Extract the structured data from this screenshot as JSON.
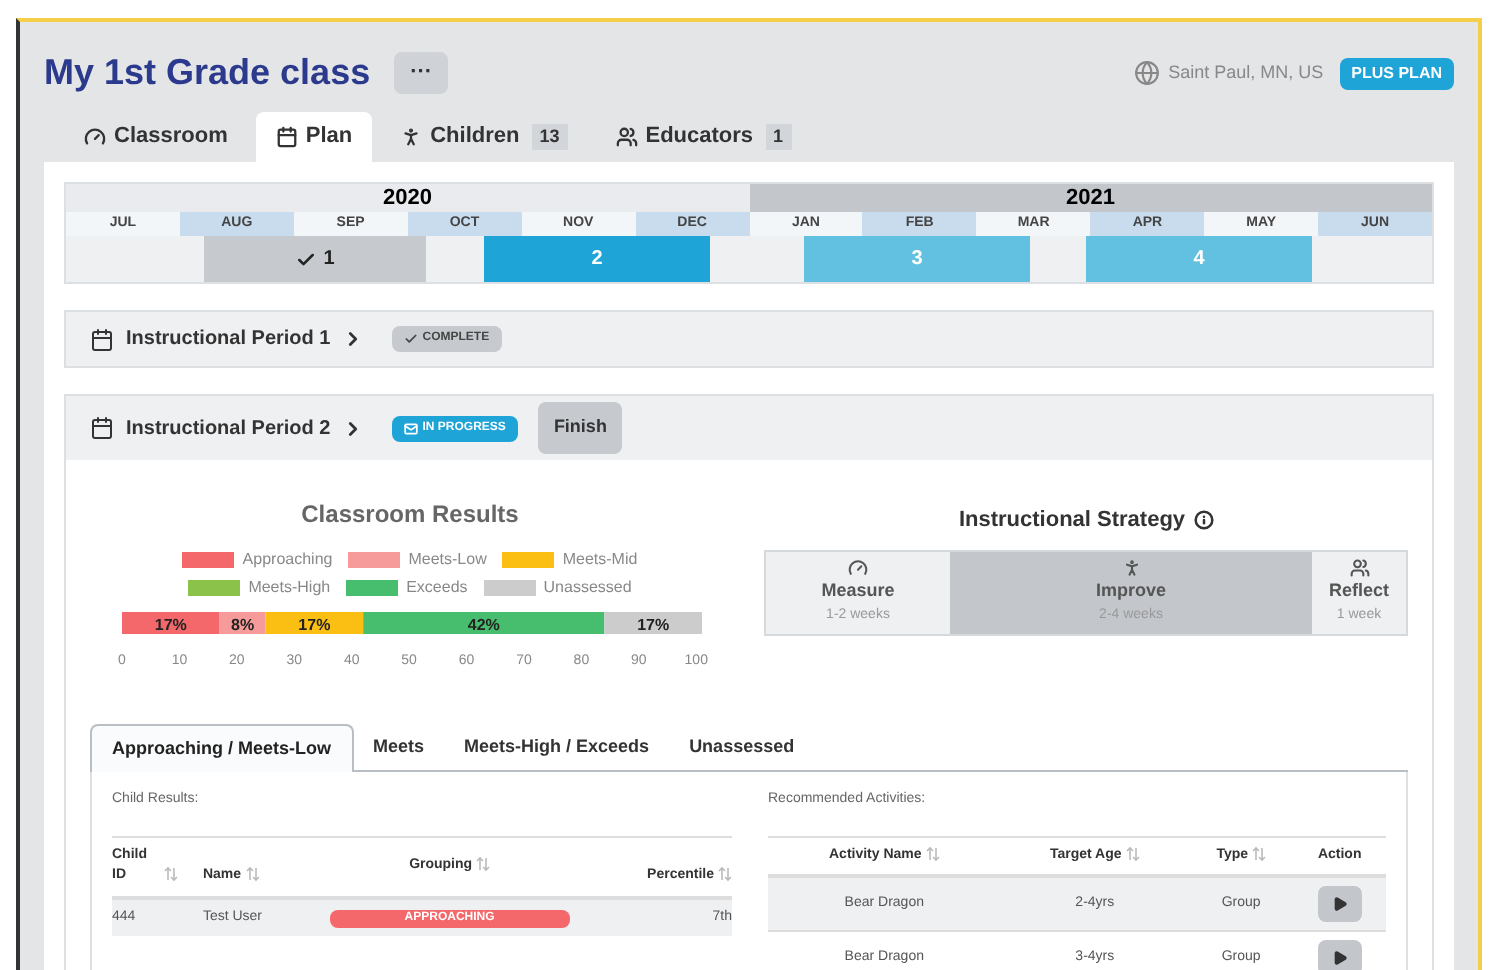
{
  "header": {
    "title": "My 1st Grade class",
    "more_button": "···",
    "location": "Saint Paul, MN, US",
    "plan_badge": "PLUS PLAN"
  },
  "tabs": [
    {
      "label": "Classroom",
      "selected": false
    },
    {
      "label": "Plan",
      "selected": true
    },
    {
      "label": "Children",
      "count": "13",
      "selected": false
    },
    {
      "label": "Educators",
      "count": "1",
      "selected": false
    }
  ],
  "timeline": {
    "years": [
      {
        "label": "2020",
        "kind": "past"
      },
      {
        "label": "2021",
        "kind": "future"
      }
    ],
    "months": [
      "JUL",
      "AUG",
      "SEP",
      "OCT",
      "NOV",
      "DEC",
      "JAN",
      "FEB",
      "MAR",
      "APR",
      "MAY",
      "JUN"
    ],
    "periods": [
      {
        "label": "1",
        "kind": "complete"
      },
      {
        "label": "2",
        "kind": "current"
      },
      {
        "label": "3",
        "kind": "upcoming"
      },
      {
        "label": "4",
        "kind": "upcoming"
      }
    ]
  },
  "periods": [
    {
      "title": "Instructional Period 1",
      "status": "COMPLETE",
      "kind": "complete"
    },
    {
      "title": "Instructional Period 2",
      "status": "IN PROGRESS",
      "kind": "current",
      "action": "Finish"
    }
  ],
  "classroom_results": {
    "chart_data": {
      "type": "bar",
      "title": "Classroom Results",
      "orientation": "horizontal",
      "stacked": true,
      "legend": true,
      "series": [
        {
          "name": "Approaching",
          "color": "#f4686b",
          "values": [
            17
          ]
        },
        {
          "name": "Meets-Low",
          "color": "#f79a9a",
          "values": [
            8
          ]
        },
        {
          "name": "Meets-Mid",
          "color": "#fbbf14",
          "values": [
            17
          ]
        },
        {
          "name": "Meets-High",
          "color": "#8bc34a",
          "values": [
            0
          ]
        },
        {
          "name": "Exceeds",
          "color": "#47bd6e",
          "values": [
            42
          ]
        },
        {
          "name": "Unassessed",
          "color": "#cccccc",
          "values": [
            17
          ]
        }
      ],
      "xlim": [
        0,
        101
      ],
      "xticks": [
        0,
        10,
        20,
        30,
        40,
        50,
        60,
        70,
        80,
        90,
        100
      ],
      "value_labels": [
        "17%",
        "8%",
        "17%",
        null,
        "42%",
        "17%"
      ]
    }
  },
  "strategy": {
    "title": "Instructional Strategy",
    "steps": [
      {
        "name": "Measure",
        "duration": "1-2 weeks",
        "selected": false
      },
      {
        "name": "Improve",
        "duration": "2-4 weeks",
        "selected": true
      },
      {
        "name": "Reflect",
        "duration": "1 week",
        "selected": false
      }
    ]
  },
  "group_tabs": [
    {
      "label": "Approaching / Meets-Low",
      "selected": true
    },
    {
      "label": "Meets",
      "selected": false
    },
    {
      "label": "Meets-High / Exceeds",
      "selected": false
    },
    {
      "label": "Unassessed",
      "selected": false
    }
  ],
  "child_results": {
    "label": "Child Results:",
    "columns": [
      {
        "label": "Child ID",
        "sortable": true
      },
      {
        "label": "Name",
        "sortable": true
      },
      {
        "label": "Grouping",
        "sortable": true
      },
      {
        "label": "Percentile",
        "sortable": true
      }
    ],
    "rows": [
      {
        "id": "444",
        "name": "Test User",
        "grouping": "APPROACHING",
        "percentile": "7th"
      }
    ]
  },
  "activities": {
    "label": "Recommended Activities:",
    "columns": [
      {
        "label": "Activity Name",
        "sortable": true
      },
      {
        "label": "Target Age",
        "sortable": true
      },
      {
        "label": "Type",
        "sortable": true
      },
      {
        "label": "Action",
        "sortable": false
      }
    ],
    "rows": [
      {
        "name": "Bear Dragon",
        "age": "2-4yrs",
        "type": "Group"
      },
      {
        "name": "Bear Dragon",
        "age": "3-4yrs",
        "type": "Group"
      }
    ]
  }
}
